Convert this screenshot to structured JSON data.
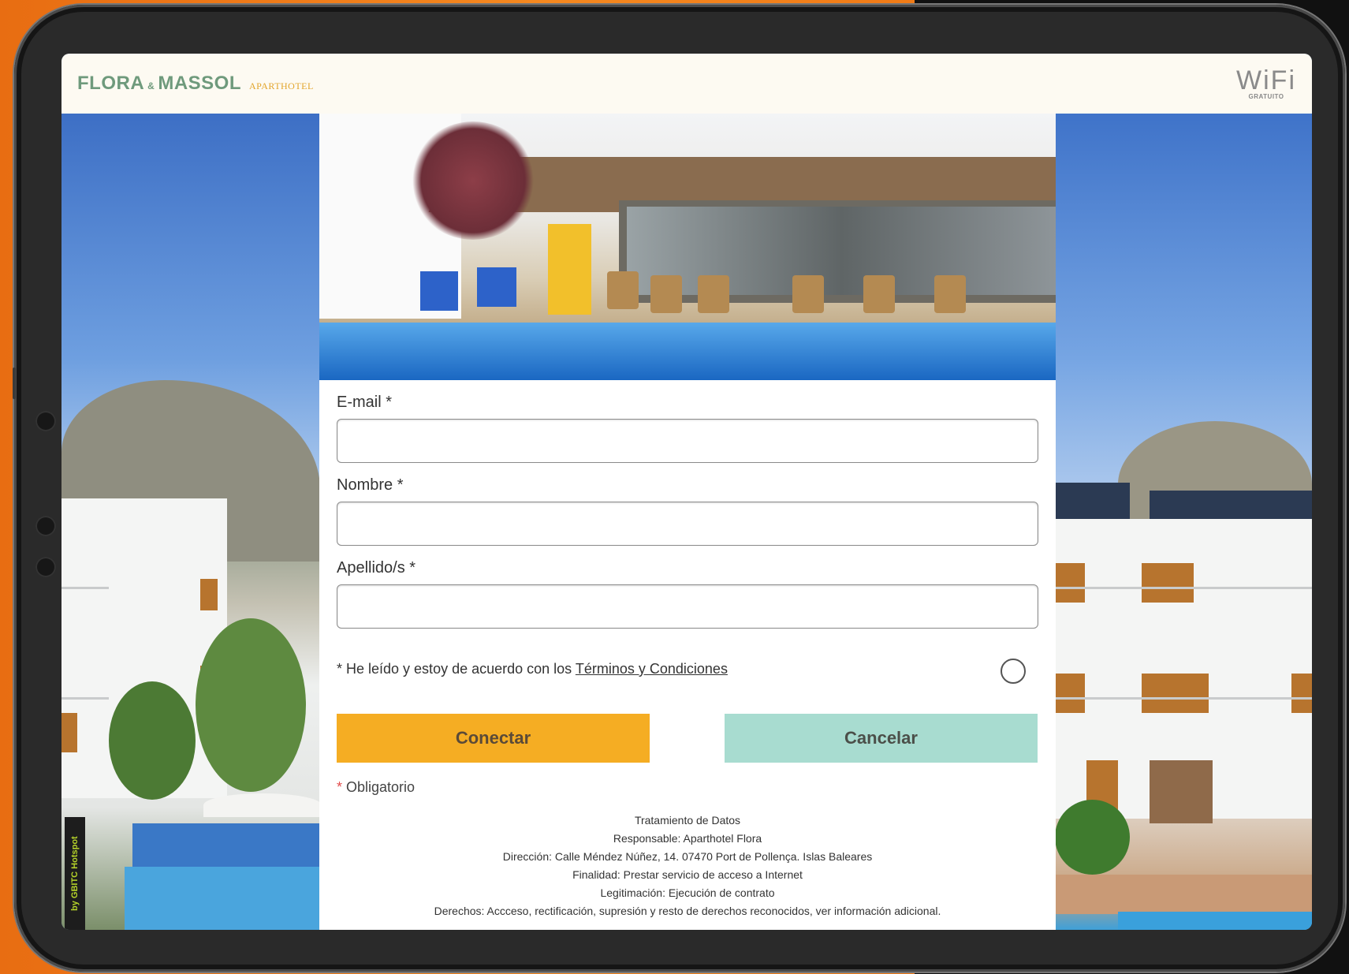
{
  "header": {
    "logo_name_part1": "FLORA",
    "logo_ampersand": "&",
    "logo_name_part2": "MASSOL",
    "logo_subtitle": "APARTHOTEL",
    "wifi_label": "WiFi",
    "wifi_sublabel": "GRATUITO"
  },
  "form": {
    "email_label": "E-mail *",
    "nombre_label": "Nombre *",
    "apellidos_label": "Apellido/s *",
    "email_value": "",
    "nombre_value": "",
    "apellidos_value": "",
    "terms_prefix": "* He leído y estoy de acuerdo con los ",
    "terms_link": "Términos y Condiciones",
    "terms_checked": false,
    "connect_button": "Conectar",
    "cancel_button": "Cancelar",
    "mandatory_star": "*",
    "mandatory_text": " Obligatorio"
  },
  "legal": {
    "title": "Tratamiento de Datos",
    "responsable": "Responsable: Aparthotel Flora",
    "direccion": "Dirección: Calle Méndez Núñez, 14. 07470 Port de Pollença. Islas Baleares",
    "finalidad": "Finalidad: Prestar servicio de acceso a Internet",
    "legitimacion": "Legitimación: Ejecución de contrato",
    "derechos": "Derechos: Accceso, rectificación, supresión y resto de derechos reconocidos, ver información adicional."
  },
  "badge": {
    "hotspot_text": "by GBITC Hotspot"
  },
  "colors": {
    "brand_green": "#6f9a7c",
    "brand_gold": "#e2a52c",
    "connect_bg": "#f5ad23",
    "cancel_bg": "#a8dcd0",
    "frame_orange": "#f07d1a"
  }
}
